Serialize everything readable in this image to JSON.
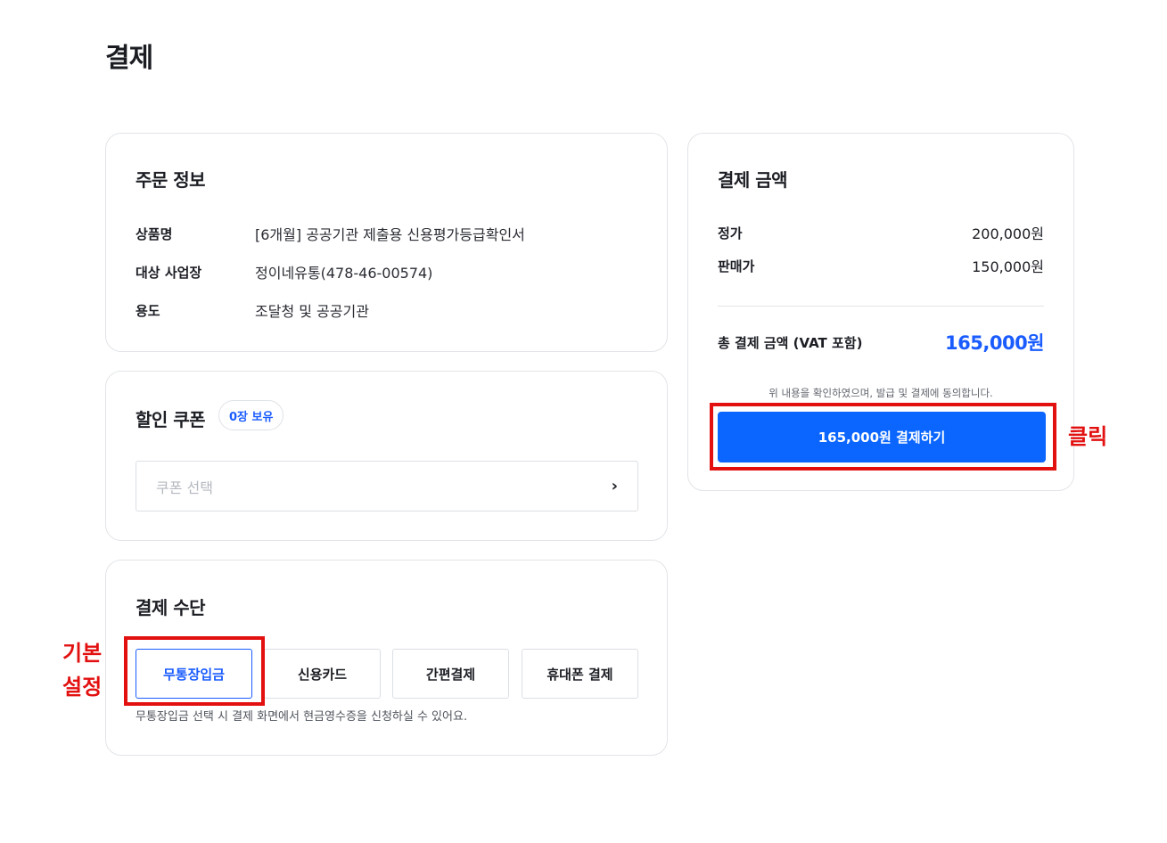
{
  "page": {
    "title": "결제"
  },
  "order_info": {
    "title": "주문 정보",
    "rows": [
      {
        "label": "상품명",
        "value": "[6개월] 공공기관 제출용 신용평가등급확인서"
      },
      {
        "label": "대상 사업장",
        "value": "정이네유통(478-46-00574)"
      },
      {
        "label": "용도",
        "value": "조달청 및 공공기관"
      }
    ]
  },
  "coupon": {
    "title": "할인 쿠폰",
    "badge": "0장 보유",
    "select_placeholder": "쿠폰 선택",
    "chevron": "›"
  },
  "payment_method": {
    "title": "결제 수단",
    "options": [
      "무통장입금",
      "신용카드",
      "간편결제",
      "휴대폰 결제"
    ],
    "selected": "무통장입금",
    "note": "무통장입금 선택 시 결제 화면에서 현금영수증을 신청하실 수 있어요."
  },
  "amount": {
    "title": "결제 금액",
    "list_price_label": "정가",
    "list_price": "200,000원",
    "sale_price_label": "판매가",
    "sale_price": "150,000원",
    "total_label": "총 결제 금액 (VAT 포함)",
    "total": "165,000원",
    "agree_note": "위 내용을 확인하였으며, 발급 및 결제에 동의합니다.",
    "pay_button": "165,000원 결제하기"
  },
  "annotations": {
    "click_label": "클릭",
    "default_label_line1": "기본",
    "default_label_line2": "설정",
    "color": "#e31010"
  },
  "colors": {
    "accent": "#1a5cff",
    "button": "#0a66ff"
  }
}
